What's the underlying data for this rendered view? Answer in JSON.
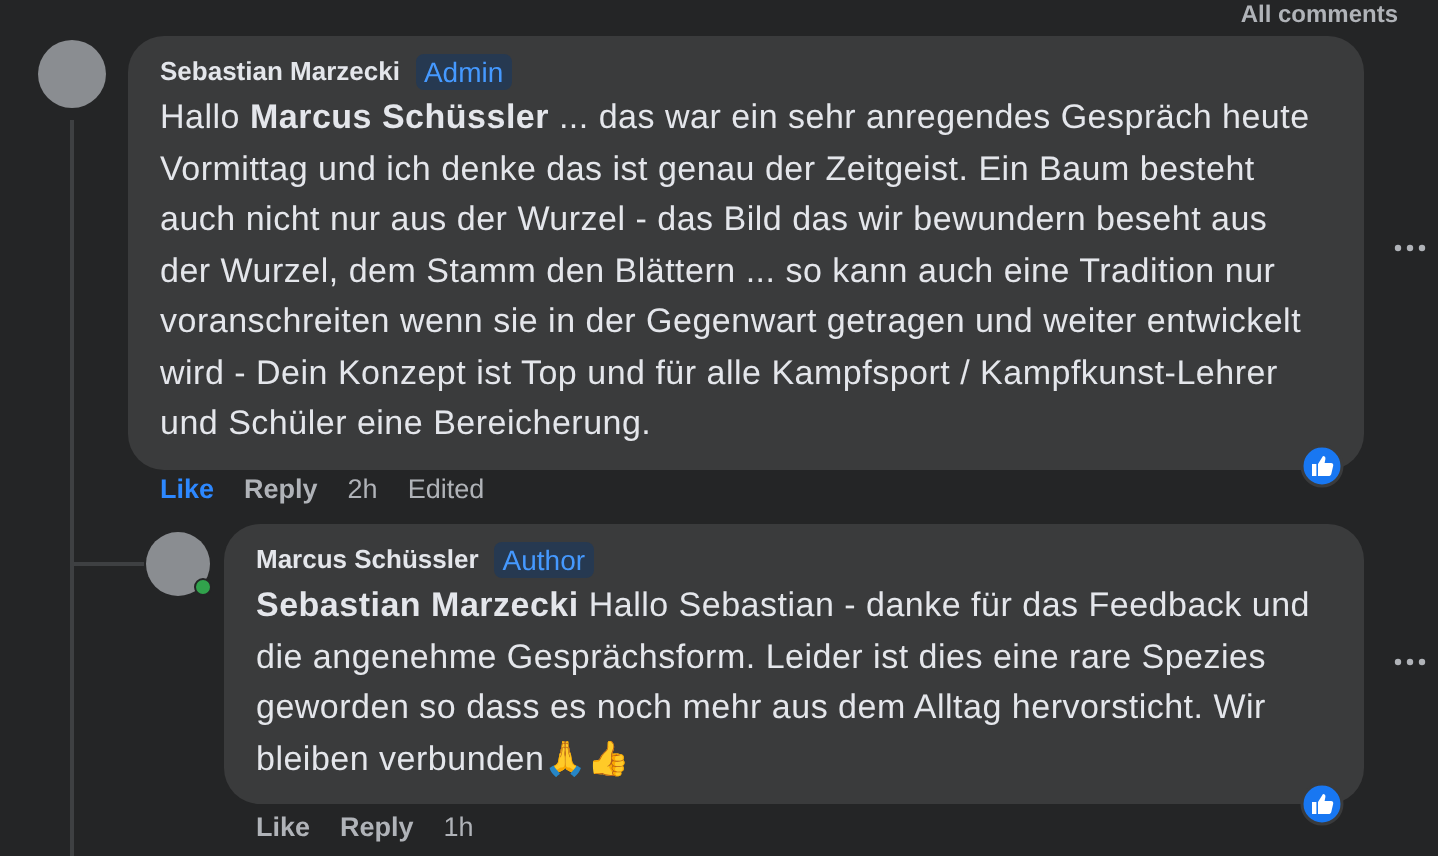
{
  "filter": {
    "label": "All comments"
  },
  "comments": [
    {
      "author": "Sebastian Marzecki",
      "badge": "Admin",
      "online": false,
      "body": "Hallo **Marcus Schüssler** ... das war ein sehr anregendes Gespräch heute Vormittag und ich denke das ist genau der Zeitgeist. Ein Baum besteht auch nicht nur aus der Wurzel - das Bild das wir bewundern beseht aus der Wurzel, dem Stamm den Blättern ... so kann auch eine Tradition nur voranschreiten wenn sie in der Gegenwart getragen und weiter entwickelt wird - Dein Konzept ist Top und für alle Kampfsport / Kampfkunst-Lehrer und Schüler eine Bereicherung.",
      "like": "Like",
      "liked": true,
      "reply": "Reply",
      "time": "2h",
      "edited": "Edited",
      "replies": [
        {
          "author": "Marcus Schüssler",
          "badge": "Author",
          "online": true,
          "body": "**Sebastian Marzecki** Hallo Sebastian - danke für das Feedback und die angenehme Gesprächsform. Leider ist dies eine rare Spezies geworden so dass es noch mehr aus dem Alltag hervorsticht. Wir bleiben verbunden🙏👍",
          "like": "Like",
          "liked": false,
          "reply": "Reply",
          "time": "1h"
        }
      ]
    }
  ]
}
